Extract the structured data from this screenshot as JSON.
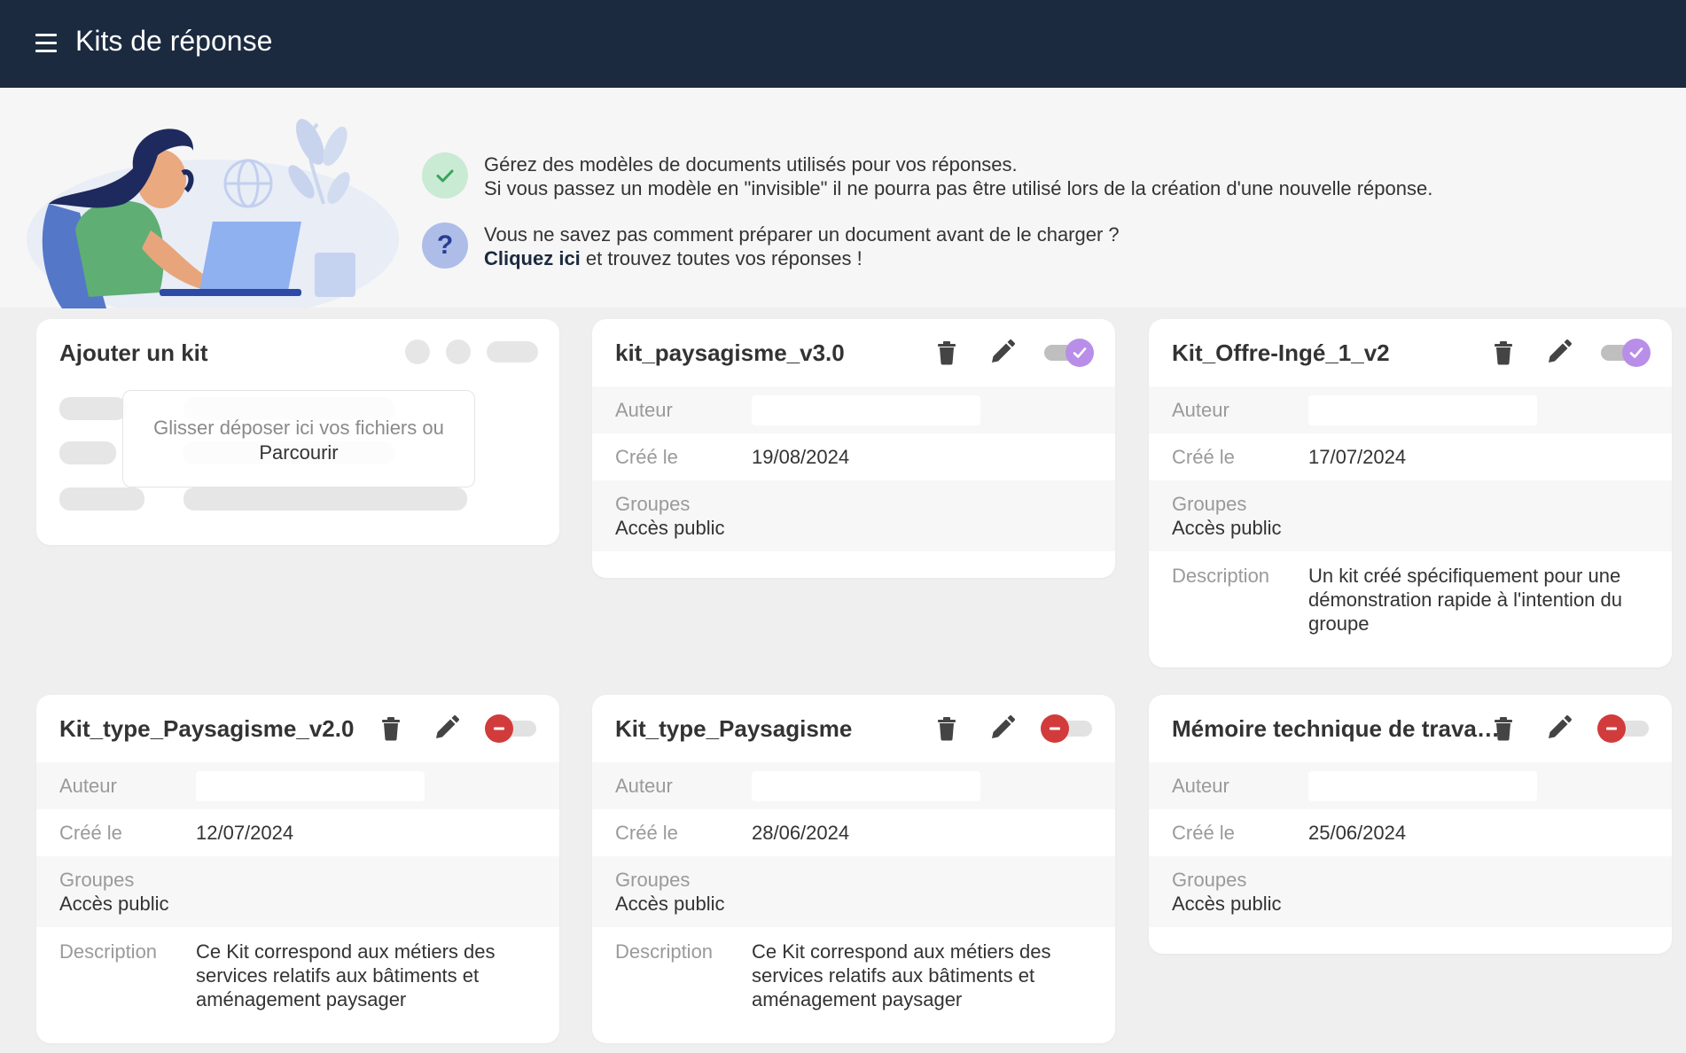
{
  "header": {
    "title": "Kits de réponse"
  },
  "banner": {
    "info_line1": "Gérez des modèles de documents utilisés pour vos réponses.",
    "info_line2": "Si vous passez un modèle en \"invisible\" il ne pourra pas être utilisé lors de la création d'une nouvelle réponse.",
    "help_line1": "Vous ne savez pas comment préparer un document avant de le charger ?",
    "help_link": "Cliquez ici",
    "help_rest": " et trouvez toutes vos réponses !"
  },
  "add_kit": {
    "title": "Ajouter un kit",
    "drop_hint": "Glisser déposer ici vos fichiers ou",
    "browse_label": "Parcourir"
  },
  "labels": {
    "author": "Auteur",
    "created": "Créé le",
    "groups": "Groupes",
    "description": "Description"
  },
  "kits": [
    {
      "title": "kit_paysagisme_v3.0",
      "visible": true,
      "created": "19/08/2024",
      "groups": "Accès public",
      "description": ""
    },
    {
      "title": "Kit_Offre-Ingé_1_v2",
      "visible": true,
      "created": "17/07/2024",
      "groups": "Accès public",
      "description": "Un kit créé spécifiquement pour une démonstration rapide à l'intention du groupe"
    },
    {
      "title": "Kit_type_Paysagisme_v2.0",
      "visible": false,
      "created": "12/07/2024",
      "groups": "Accès public",
      "description": "Ce Kit correspond aux métiers des services relatifs aux bâtiments et aménagement paysager"
    },
    {
      "title": "Kit_type_Paysagisme",
      "visible": false,
      "created": "28/06/2024",
      "groups": "Accès public",
      "description": "Ce Kit correspond aux métiers des services relatifs aux bâtiments et aménagement paysager"
    },
    {
      "title": "Mémoire technique de travau...",
      "visible": false,
      "created": "25/06/2024",
      "groups": "Accès public",
      "description": ""
    }
  ],
  "colors": {
    "appbar": "#1b2a3f",
    "toggle_on": "#b98ee8",
    "toggle_off": "#d23b3b"
  },
  "icons": {
    "menu": "hamburger-menu-icon",
    "check": "check-icon",
    "help": "question-icon",
    "delete": "trash-icon",
    "edit": "pencil-icon"
  }
}
